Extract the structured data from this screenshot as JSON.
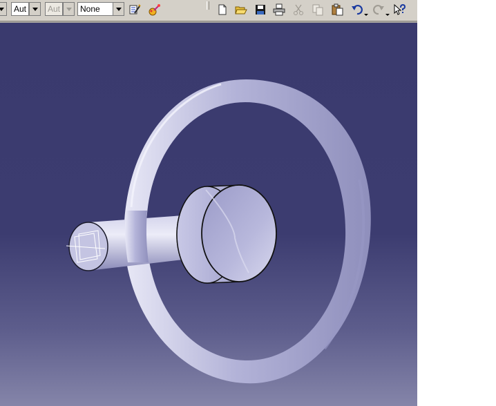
{
  "toolbar": {
    "combo_1": "Aut",
    "combo_2": "Aut",
    "combo_3": "None",
    "icons": [
      "painter-icon",
      "color-wand-icon",
      "new-document-icon",
      "open-folder-icon",
      "save-icon",
      "print-icon",
      "cut-icon",
      "copy-icon",
      "paste-icon",
      "undo-icon",
      "redo-icon",
      "whats-this-help-icon"
    ]
  },
  "viewport": {
    "background_top": "#3a3a6e",
    "background_bottom": "#8585a9",
    "model_color": "#b7b7dc",
    "object": "steering-wheel-part-model"
  }
}
